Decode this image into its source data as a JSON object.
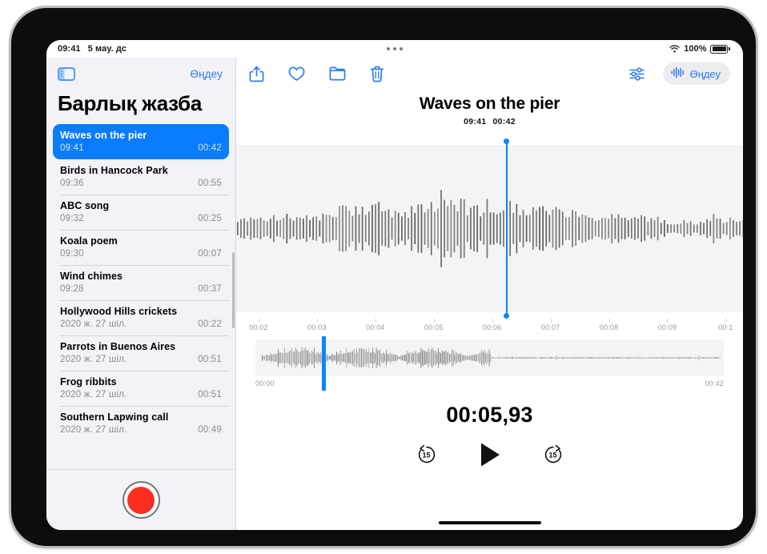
{
  "status_bar": {
    "time": "09:41",
    "date": "5 мау. дс",
    "wifi_icon": "wifi-icon",
    "battery_percent": "100%",
    "multitask_icon": "multitasking-dots-icon"
  },
  "sidebar": {
    "toggle_icon": "sidebar-toggle-icon",
    "edit_label": "Өңдеу",
    "title": "Барлық жазба",
    "record_icon": "record-icon",
    "items": [
      {
        "title": "Waves on the pier",
        "date": "09:41",
        "duration": "00:42",
        "selected": true
      },
      {
        "title": "Birds in Hancock Park",
        "date": "09:36",
        "duration": "00:55",
        "selected": false
      },
      {
        "title": "ABC song",
        "date": "09:32",
        "duration": "00:25",
        "selected": false
      },
      {
        "title": "Koala poem",
        "date": "09:30",
        "duration": "00:07",
        "selected": false
      },
      {
        "title": "Wind chimes",
        "date": "09:28",
        "duration": "00:37",
        "selected": false
      },
      {
        "title": "Hollywood Hills crickets",
        "date": "2020 ж. 27 шіл.",
        "duration": "00:22",
        "selected": false
      },
      {
        "title": "Parrots in Buenos Aires",
        "date": "2020 ж. 27 шіл.",
        "duration": "00:51",
        "selected": false
      },
      {
        "title": "Frog ribbits",
        "date": "2020 ж. 27 шіл.",
        "duration": "00:51",
        "selected": false
      },
      {
        "title": "Southern Lapwing call",
        "date": "2020 ж. 27 шіл.",
        "duration": "00:49",
        "selected": false
      }
    ]
  },
  "toolbar": {
    "share_icon": "share-icon",
    "favorite_icon": "heart-icon",
    "folder_icon": "folder-icon",
    "delete_icon": "trash-icon",
    "adjust_icon": "sliders-icon",
    "edit_waveform_icon": "waveform-icon",
    "edit_label": "Өңдеу"
  },
  "main": {
    "title": "Waves on the pier",
    "recorded_time": "09:41",
    "duration": "00:42",
    "ruler_labels": [
      "00:02",
      "00:03",
      "00:04",
      "00:05",
      "00:06",
      "00:07",
      "00:08",
      "00:09",
      "00:1"
    ],
    "overview_start": "00:00",
    "overview_end": "00:42",
    "timer": "00:05,93",
    "playhead_percent": 53.2,
    "overview_playhead_percent": 14.2
  },
  "transport": {
    "skip_back_label": "15",
    "skip_back_icon": "skip-back-15-icon",
    "play_icon": "play-icon",
    "skip_forward_label": "15",
    "skip_forward_icon": "skip-forward-15-icon"
  },
  "colors": {
    "accent_blue": "#0a7cff",
    "toolbar_blue": "#2f7cf6",
    "record_red": "#fc2e20",
    "sidebar_bg": "#f2f2f7",
    "wave_bg": "#f4f4f6",
    "muted_text": "#8a8a8e"
  }
}
